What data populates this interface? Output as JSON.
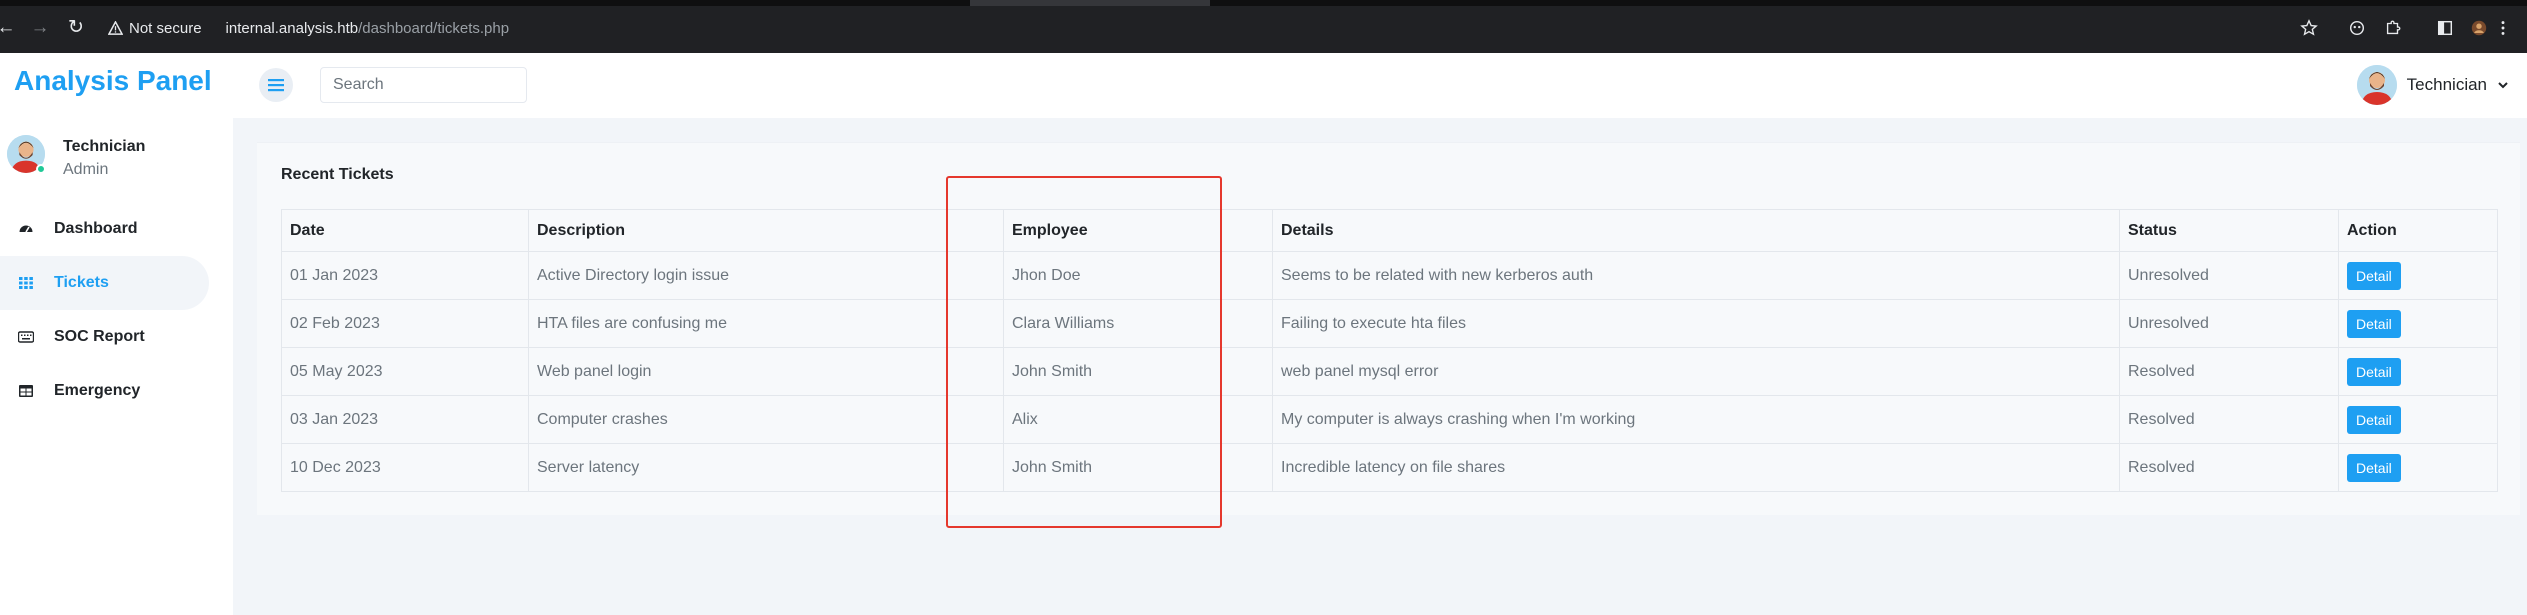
{
  "browser": {
    "security_label": "Not secure",
    "url_host": "internal.analysis.htb",
    "url_path": "/dashboard/tickets.php"
  },
  "header": {
    "brand": "Analysis Panel",
    "search_placeholder": "Search",
    "user_name": "Technician"
  },
  "sidebar": {
    "user_name": "Technician",
    "user_role": "Admin",
    "items": [
      {
        "label": "Dashboard",
        "icon": "gauge-icon",
        "active": false
      },
      {
        "label": "Tickets",
        "icon": "grid-icon",
        "active": true
      },
      {
        "label": "SOC Report",
        "icon": "keyboard-icon",
        "active": false
      },
      {
        "label": "Emergency",
        "icon": "table-icon",
        "active": false
      }
    ]
  },
  "tickets": {
    "title": "Recent Tickets",
    "columns": [
      "Date",
      "Description",
      "Employee",
      "Details",
      "Status",
      "Action"
    ],
    "rows": [
      {
        "date": "01 Jan 2023",
        "description": "Active Directory login issue",
        "employee": "Jhon Doe",
        "details": "Seems to be related with new kerberos auth",
        "status": "Unresolved",
        "action": "Detail"
      },
      {
        "date": "02 Feb 2023",
        "description": "HTA files are confusing me",
        "employee": "Clara Williams",
        "details": "Failing to execute hta files",
        "status": "Unresolved",
        "action": "Detail"
      },
      {
        "date": "05 May 2023",
        "description": "Web panel login",
        "employee": "John Smith",
        "details": "web panel mysql error",
        "status": "Resolved",
        "action": "Detail"
      },
      {
        "date": "03 Jan 2023",
        "description": "Computer crashes",
        "employee": "Alix",
        "details": "My computer is always crashing when I'm working",
        "status": "Resolved",
        "action": "Detail"
      },
      {
        "date": "10 Dec 2023",
        "description": "Server latency",
        "employee": "John Smith",
        "details": "Incredible latency on file shares",
        "status": "Resolved",
        "action": "Detail"
      }
    ]
  },
  "colors": {
    "accent": "#1e9ff2",
    "highlight": "#e5382d",
    "online": "#20c997"
  }
}
